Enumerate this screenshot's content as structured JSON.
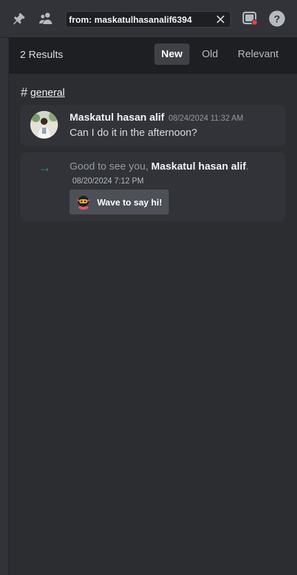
{
  "search": {
    "value": "from: maskatulhasanalif6394"
  },
  "icons": {
    "pin": "pin-icon",
    "members": "members-icon",
    "clear": "close-icon",
    "inbox": "inbox-icon",
    "help": "help-icon"
  },
  "results": {
    "count_label": "2 Results",
    "sort_tabs": [
      {
        "label": "New",
        "active": true
      },
      {
        "label": "Old",
        "active": false
      },
      {
        "label": "Relevant",
        "active": false
      }
    ]
  },
  "channel": {
    "hash": "#",
    "name": "general"
  },
  "messages": [
    {
      "author": "Maskatul hasan alif",
      "timestamp": "08/24/2024 11:32 AM",
      "text": "Can I do it in the afternoon?"
    },
    {
      "type": "join",
      "prefix": "Good to see you, ",
      "author": "Maskatul hasan alif",
      "suffix": ".",
      "timestamp": "08/20/2024 7:12 PM",
      "button_label": "Wave to say hi!"
    }
  ],
  "colors": {
    "accent_green": "#23a55a",
    "status_red": "#f23f43",
    "background": "#2b2d31"
  }
}
